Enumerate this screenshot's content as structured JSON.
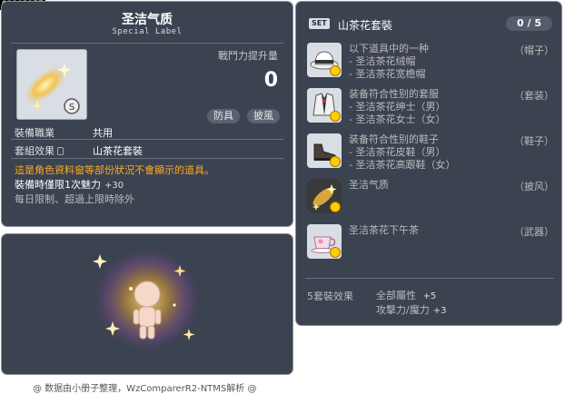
{
  "item_id": "01103157",
  "tooltip": {
    "title": "圣洁气质",
    "subtitle": "Special Label",
    "combat_label": "戰鬥力提升量",
    "combat_value": "0",
    "tags": [
      "防具",
      "披風"
    ],
    "job_label": "裝備職業",
    "job_value": "共用",
    "set_label": "套組效果",
    "set_value": "山茶花套裝",
    "desc_orange": "這是角色資料窗等部份狀況不會顯示的道具。",
    "charm_label": "裝備時僅限1次魅力",
    "charm_value": "+30",
    "limit_text": "每日限制、超過上限時除外"
  },
  "set": {
    "badge": "SET",
    "name": "山茶花套裝",
    "count": "0 / 5",
    "items": [
      {
        "lines": [
          "以下道具中的一种",
          "- 圣洁茶花绒帽",
          "- 圣洁茶花宽檐帽"
        ],
        "type": "（帽子）",
        "icon": "hat-icon"
      },
      {
        "lines": [
          "装备符合性别的套服",
          "- 圣洁茶花绅士（男）",
          "- 圣洁茶花女士（女）"
        ],
        "type": "（套装）",
        "icon": "suit-icon"
      },
      {
        "lines": [
          "装备符合性别的鞋子",
          "- 圣洁茶花皮鞋（男）",
          "- 圣洁茶花高跟鞋（女）"
        ],
        "type": "（鞋子）",
        "icon": "shoe-icon"
      },
      {
        "lines": [
          "圣洁气质"
        ],
        "type": "（披风）",
        "icon": "cape-sparkle-icon"
      },
      {
        "lines": [
          "圣洁茶花下午茶"
        ],
        "type": "（武器）",
        "icon": "teacup-icon"
      }
    ],
    "bonus_label": "5套裝效果",
    "bonus_lines": [
      {
        "text": "全部屬性",
        "value": "+5"
      },
      {
        "text": "攻擊力/魔力",
        "value": "+3"
      }
    ]
  },
  "credit": "@ 数据由小册子整理，WzComparerR2-NTMS解析 @",
  "colors": {
    "panel_bg": "#3b4250",
    "accent_orange": "#ffaa22",
    "text_grey": "#bbbbbb"
  }
}
